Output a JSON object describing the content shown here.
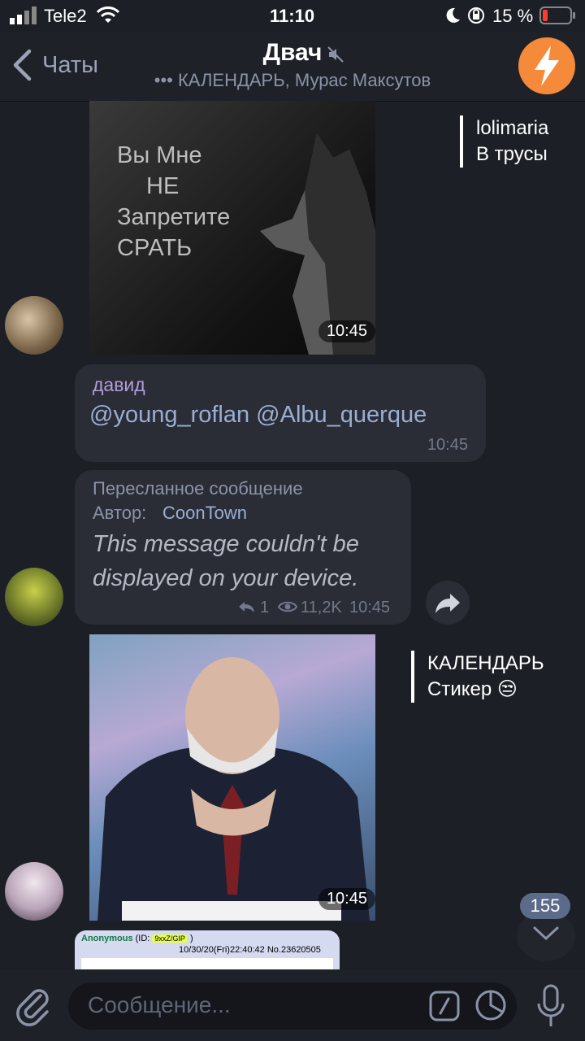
{
  "status": {
    "carrier": "Tele2",
    "time": "11:10",
    "battery": "15 %"
  },
  "header": {
    "back_label": "Чаты",
    "title": "Двач",
    "subtitle": "••• КАЛЕНДАРЬ, Мурас Максутов"
  },
  "messages": {
    "wolf": {
      "caption_lines": [
        "Вы Мне",
        "НЕ",
        "Запретите",
        "СРАТЬ"
      ],
      "time": "10:45",
      "reply_author": "lolimaria",
      "reply_text": "В трусы"
    },
    "david": {
      "author": "давид",
      "text": "@young_roflan @Albu_querque",
      "time": "10:45"
    },
    "forwarded": {
      "header": "Пересланное сообщение",
      "author_label": "Автор:",
      "author_name": "CoonTown",
      "text": "This message couldn't be displayed on your device.",
      "replies": "1",
      "views": "11,2K",
      "time": "10:45"
    },
    "man_photo": {
      "time": "10:45",
      "reply_author": "КАЛЕНДАРЬ",
      "reply_text": "Стикер 😒"
    },
    "anon_post": {
      "name": "Anonymous",
      "id_label": "(ID:",
      "id_value": "9xxZ/GIP",
      "id_close": ")",
      "date_num": "10/30/20(Fri)22:40:42 No.23620505"
    }
  },
  "scroll_down": {
    "unread_count": "155"
  },
  "input": {
    "placeholder": "Сообщение..."
  },
  "colors": {
    "background": "#1c1f26",
    "bubble": "#2a2d35",
    "accent_orange": "#f58a3b",
    "link": "#9aaed3",
    "username": "#b39ddb"
  }
}
